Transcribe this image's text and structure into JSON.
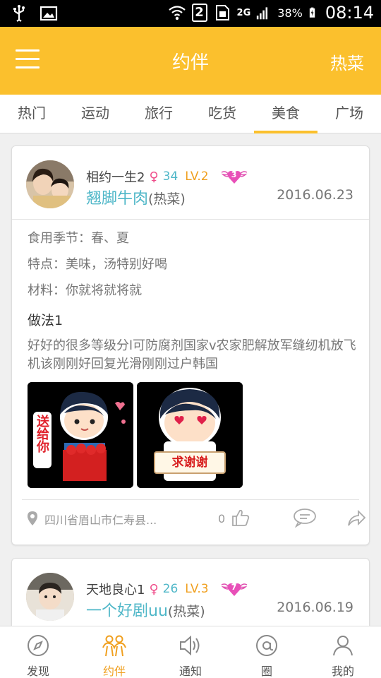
{
  "status_bar": {
    "sim_slot": "2",
    "network": "2G",
    "battery": "38%",
    "time": "08:14"
  },
  "header": {
    "title": "约伴",
    "action_label": "热菜",
    "accent_color": "#fbc02d"
  },
  "tabs": [
    {
      "label": "热门",
      "active": false
    },
    {
      "label": "运动",
      "active": false
    },
    {
      "label": "旅行",
      "active": false
    },
    {
      "label": "吃货",
      "active": false
    },
    {
      "label": "美食",
      "active": true
    },
    {
      "label": "广场",
      "active": false
    }
  ],
  "posts": [
    {
      "username": "相约一生2",
      "gender_symbol": "♀",
      "age": "34",
      "level": "LV.2",
      "heart_count": "3",
      "dish_name": "翘脚牛肉",
      "dish_tag": "(热菜)",
      "date": "2016.06.23",
      "season": "食用季节：春、夏",
      "feature": "特点：美味，汤特别好喝",
      "ingredients": "材料：你就将就将就",
      "method_title": "做法1",
      "method_text": "好好的很多等级分l可防腐剂国家v农家肥解放军缝纫机放飞机该刚刚好回复光滑刚刚过户韩国",
      "photo1_caption": "送给你",
      "photo2_caption": "求谢谢",
      "location": "四川省眉山市仁寿县...",
      "likes": "0"
    },
    {
      "username": "天地良心1",
      "gender_symbol": "♀",
      "age": "26",
      "level": "LV.3",
      "heart_count": "7",
      "dish_name": "一个好剧uu",
      "dish_tag": "(热菜)",
      "date": "2016.06.19"
    }
  ],
  "bottom_nav": [
    {
      "label": "发现",
      "icon": "compass-icon",
      "active": false
    },
    {
      "label": "约伴",
      "icon": "people-icon",
      "active": true
    },
    {
      "label": "通知",
      "icon": "speaker-icon",
      "active": false
    },
    {
      "label": "圈",
      "icon": "at-icon",
      "active": false
    },
    {
      "label": "我的",
      "icon": "person-icon",
      "active": false
    }
  ]
}
